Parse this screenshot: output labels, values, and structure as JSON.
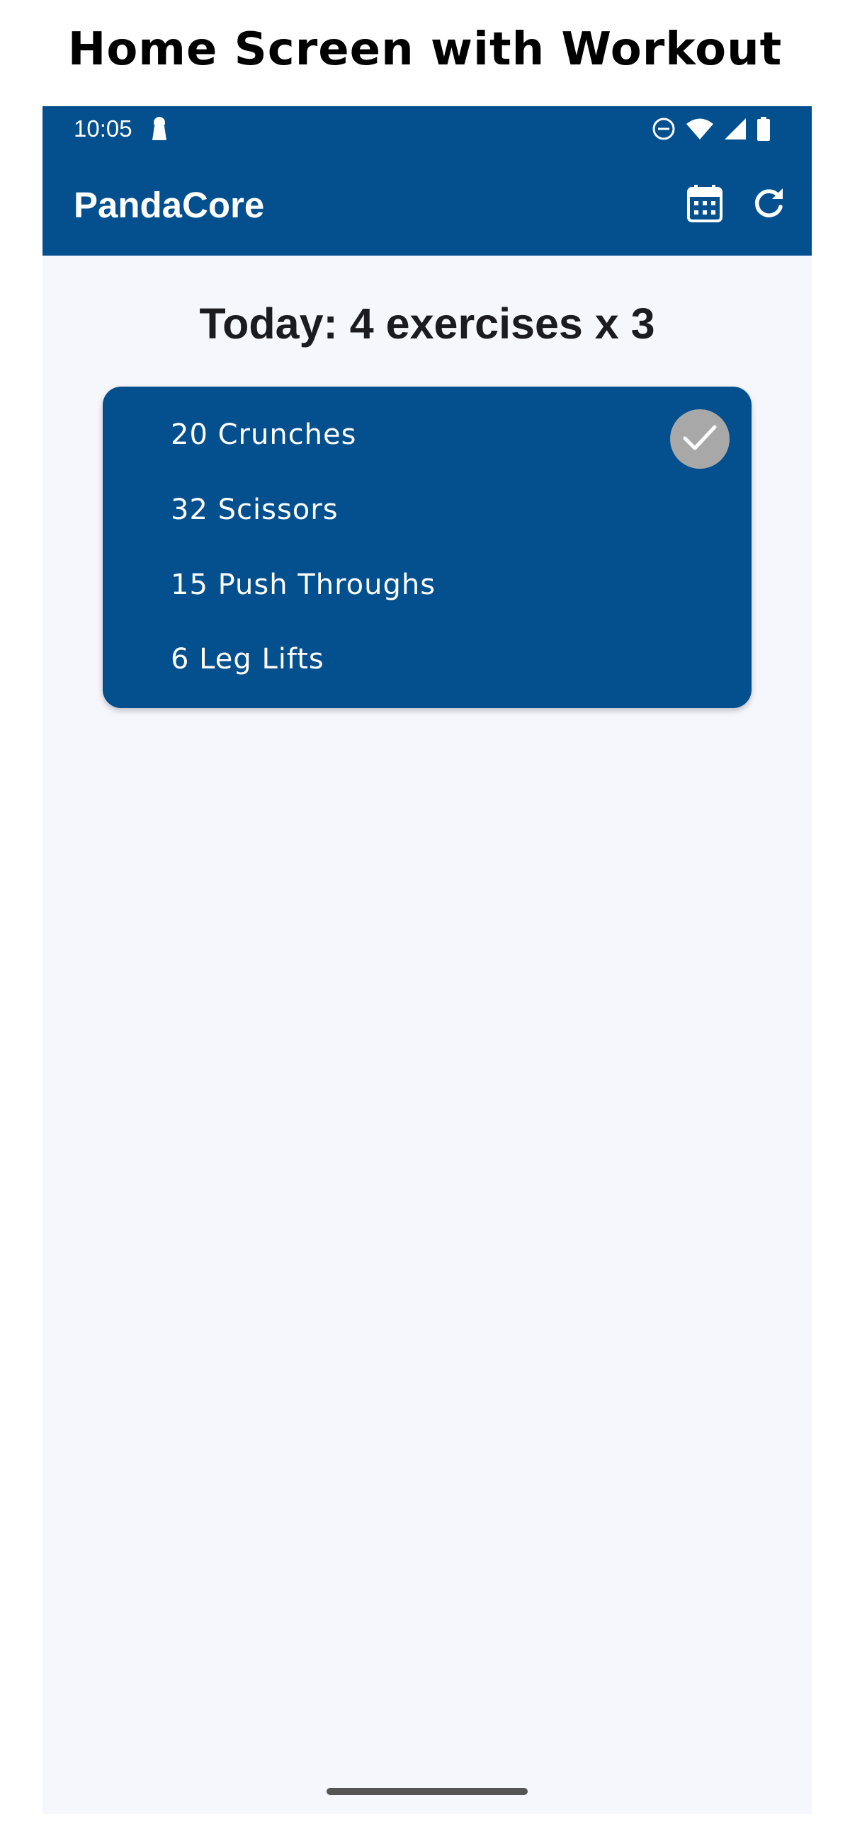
{
  "caption": "Home Screen with Workout",
  "status_bar": {
    "time": "10:05",
    "icons": [
      "key-icon",
      "do-not-disturb-icon",
      "wifi-icon",
      "cellular-signal-icon",
      "battery-icon"
    ]
  },
  "app_bar": {
    "title": "PandaCore",
    "actions": [
      "calendar-icon",
      "refresh-icon"
    ],
    "background_color": "#044f8d"
  },
  "main": {
    "today_title": "Today: 4 exercises x 3",
    "workout": {
      "exercises": [
        {
          "label": "20 Crunches",
          "completed": true
        },
        {
          "label": "32 Scissors",
          "completed": false
        },
        {
          "label": "15 Push Throughs",
          "completed": false
        },
        {
          "label": "6 Leg Lifts",
          "completed": false
        }
      ],
      "card_color": "#044f8d",
      "badge_color": "#a8a8a8"
    }
  }
}
